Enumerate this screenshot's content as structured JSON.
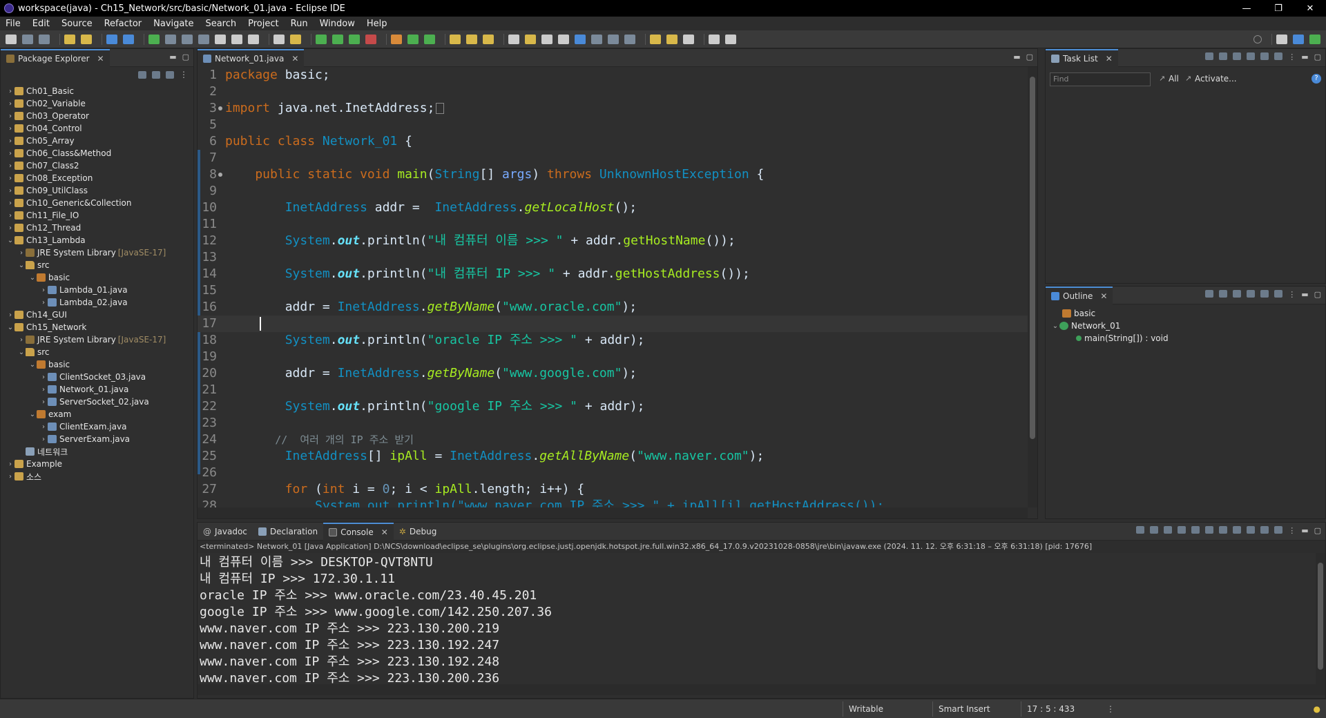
{
  "window": {
    "title": "workspace(java) - Ch15_Network/src/basic/Network_01.java - Eclipse IDE",
    "minimize": "—",
    "maximize": "❐",
    "close": "✕"
  },
  "menu": [
    "File",
    "Edit",
    "Source",
    "Refactor",
    "Navigate",
    "Search",
    "Project",
    "Run",
    "Window",
    "Help"
  ],
  "package_explorer": {
    "tab": "Package Explorer",
    "items": [
      {
        "label": "Ch01_Basic"
      },
      {
        "label": "Ch02_Variable"
      },
      {
        "label": "Ch03_Operator"
      },
      {
        "label": "Ch04_Control"
      },
      {
        "label": "Ch05_Array"
      },
      {
        "label": "Ch06_Class&Method"
      },
      {
        "label": "Ch07_Class2"
      },
      {
        "label": "Ch08_Exception"
      },
      {
        "label": "Ch09_UtilClass"
      },
      {
        "label": "Ch10_Generic&Collection"
      },
      {
        "label": "Ch11_File_IO"
      },
      {
        "label": "Ch12_Thread"
      },
      {
        "label": "Ch13_Lambda"
      },
      {
        "label": "JRE System Library",
        "extra": "[JavaSE-17]"
      },
      {
        "label": "src"
      },
      {
        "label": "basic"
      },
      {
        "label": "Lambda_01.java"
      },
      {
        "label": "Lambda_02.java"
      },
      {
        "label": "Ch14_GUI"
      },
      {
        "label": "Ch15_Network"
      },
      {
        "label": "JRE System Library",
        "extra": "[JavaSE-17]"
      },
      {
        "label": "src"
      },
      {
        "label": "basic"
      },
      {
        "label": "ClientSocket_03.java"
      },
      {
        "label": "Network_01.java"
      },
      {
        "label": "ServerSocket_02.java"
      },
      {
        "label": "exam"
      },
      {
        "label": "ClientExam.java"
      },
      {
        "label": "ServerExam.java"
      },
      {
        "label": "네트워크"
      },
      {
        "label": "Example"
      },
      {
        "label": "소스"
      }
    ]
  },
  "editor": {
    "tab": "Network_01.java",
    "line_numbers": [
      "1",
      "2",
      "3",
      "5",
      "6",
      "7",
      "8",
      "9",
      "10",
      "11",
      "12",
      "13",
      "14",
      "15",
      "16",
      "17",
      "18",
      "19",
      "20",
      "21",
      "22",
      "23",
      "24",
      "25",
      "26",
      "27",
      "28"
    ]
  },
  "code": {
    "l1a": "package",
    "l1b": " basic;",
    "l3a": "import",
    "l3b": " java.net.InetAddress;",
    "l6a": "public class",
    "l6b": " Network_01",
    "l6c": " {",
    "l8a": "    public static void",
    "l8b": " main",
    "l8c": "(",
    "l8d": "String",
    "l8e": "[] ",
    "l8f": "args",
    "l8g": ") ",
    "l8h": "throws",
    "l8i": " UnknownHostException",
    "l8j": " {",
    "l10a": "        InetAddress",
    "l10b": " addr = ",
    "l10c": " InetAddress",
    ".": ".",
    "l10d": "getLocalHost",
    "l10e": "();",
    "l12a": "        System",
    "l12b": ".",
    "l12c": "out",
    "l12d": ".println(",
    "l12e": "\"내 컴퓨터 이름 >>> \"",
    "l12f": " + addr.",
    "l12g": "getHostName",
    "l12h": "());",
    "l14e": "\"내 컴퓨터 IP >>> \"",
    "l14f": " + addr.",
    "l14g": "getHostAddress",
    "l14h": "());",
    "l16a": "        addr = ",
    "l16b": "InetAddress",
    "l16c": ".",
    "l16d": "getByName",
    "l16e": "(",
    "l16f": "\"www.oracle.com\"",
    "l16g": ");",
    "l18e": "\"oracle IP 주소 >>> \"",
    "l18f": " + addr);",
    "l20f": "\"www.google.com\"",
    "l22e": "\"google IP 주소 >>> \"",
    "l24": "        //  여러 개의 IP 주소 받기",
    "l25a": "        InetAddress",
    "l25b": "[] ",
    "l25c": "ipAll",
    "l25d": " = ",
    "l25e": "InetAddress",
    "l25f": ".",
    "l25g": "getAllByName",
    "l25h": "(",
    "l25i": "\"www.naver.com\"",
    "l25j": ");",
    "l27a": "        for",
    "l27b": " (",
    "l27c": "int",
    "l27d": " i = ",
    "l27e": "0",
    "l27f": "; i < ",
    "l27g": "ipAll",
    "l27h": ".length; i++) {",
    "l28": "            System.out.println(\"www.naver.com IP 주소 >>> \" + ipAll[i].getHostAddress());"
  },
  "task_list": {
    "tab": "Task List",
    "find_placeholder": "Find",
    "all": "All",
    "activate": "Activate..."
  },
  "outline": {
    "tab": "Outline",
    "items": [
      "basic",
      "Network_01",
      "main(String[]) : void"
    ]
  },
  "bottom_tabs": [
    "Javadoc",
    "Declaration",
    "Console",
    "Debug"
  ],
  "console": {
    "terminated": "<terminated> Network_01 [Java Application] D:\\NCS\\download\\eclipse_se\\plugins\\org.eclipse.justj.openjdk.hotspot.jre.full.win32.x86_64_17.0.9.v20231028-0858\\jre\\bin\\javaw.exe  (2024. 11. 12. 오후 6:31:18 – 오후 6:31:18) [pid: 17676]",
    "lines": [
      "내 컴퓨터 이름 >>> DESKTOP-QVT8NTU",
      "내 컴퓨터 IP >>> 172.30.1.11",
      "oracle IP 주소 >>> www.oracle.com/23.40.45.201",
      "google IP 주소 >>> www.google.com/142.250.207.36",
      "www.naver.com IP 주소 >>> 223.130.200.219",
      "www.naver.com IP 주소 >>> 223.130.192.247",
      "www.naver.com IP 주소 >>> 223.130.192.248",
      "www.naver.com IP 주소 >>> 223.130.200.236"
    ]
  },
  "status": {
    "writable": "Writable",
    "insert": "Smart Insert",
    "position": "17 : 5 : 433"
  }
}
